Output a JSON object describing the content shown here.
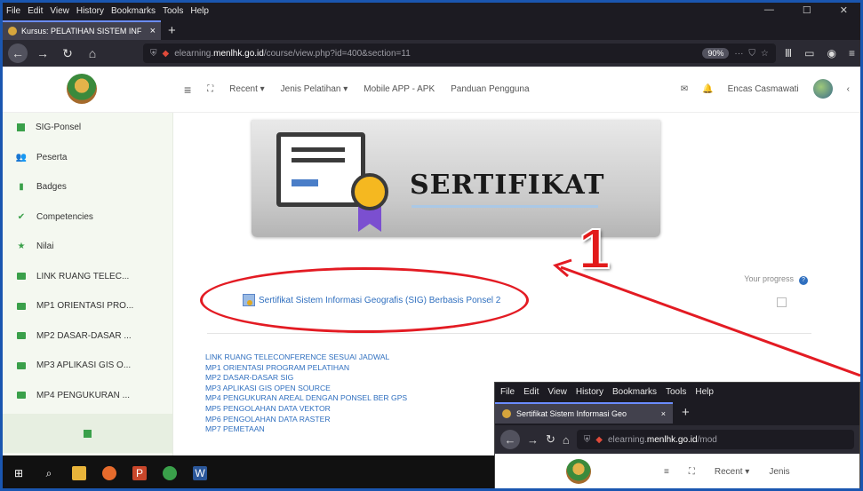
{
  "menubar": {
    "items": [
      "File",
      "Edit",
      "View",
      "History",
      "Bookmarks",
      "Tools",
      "Help"
    ]
  },
  "tab": {
    "title": "Kursus: PELATIHAN SISTEM INF",
    "close": "×",
    "new": "+"
  },
  "url": {
    "prefix": "elearning.",
    "host": "menlhk.go.id",
    "path": "/course/view.php?id=400&section=11",
    "zoom": "90%"
  },
  "topnav": {
    "menu": [
      "Recent ▾",
      "Jenis Pelatihan ▾",
      "Mobile APP - APK",
      "Panduan Pengguna"
    ],
    "user": "Encas Casmawati"
  },
  "sidebar": {
    "items": [
      {
        "label": "SIG-Ponsel",
        "icon": "square"
      },
      {
        "label": "Peserta",
        "icon": "users"
      },
      {
        "label": "Badges",
        "icon": "bookmark"
      },
      {
        "label": "Competencies",
        "icon": "check"
      },
      {
        "label": "Nilai",
        "icon": "star"
      },
      {
        "label": "LINK RUANG TELEC...",
        "icon": "folder"
      },
      {
        "label": "MP1 ORIENTASI PRO...",
        "icon": "folder"
      },
      {
        "label": "MP2 DASAR-DASAR ...",
        "icon": "folder"
      },
      {
        "label": "MP3 APLIKASI GIS O...",
        "icon": "folder"
      },
      {
        "label": "MP4 PENGUKURAN ...",
        "icon": "folder"
      }
    ]
  },
  "banner": {
    "title": "SERTIFIKAT",
    "number": "1"
  },
  "progress": {
    "label": "Your progress",
    "help": "?"
  },
  "activity": {
    "label": "Sertifikat Sistem Informasi Geografis (SIG) Berbasis Ponsel 2"
  },
  "links": [
    "LINK RUANG TELECONFERENCE SESUAI JADWAL",
    "MP1 ORIENTASI PROGRAM PELATIHAN",
    "MP2 DASAR-DASAR SIG",
    "MP3 APLIKASI GIS OPEN SOURCE",
    "MP4 PENGUKURAN AREAL DENGAN PONSEL BER GPS",
    "MP5 PENGOLAHAN DATA VEKTOR",
    "MP6 PENGOLAHAN DATA RASTER",
    "MP7 PEMETAAN"
  ],
  "inset": {
    "menubar": [
      "File",
      "Edit",
      "View",
      "History",
      "Bookmarks",
      "Tools",
      "Help"
    ],
    "tab": "Sertifikat Sistem Informasi Geo",
    "close": "×",
    "new": "+",
    "url_prefix": "elearning.",
    "url_host": "menlhk.go.id",
    "url_path": "/mod",
    "nav": [
      "Recent ▾",
      "Jenis"
    ]
  },
  "colors": {
    "accent": "#2f6fbf",
    "highlight": "#e31b23",
    "sidebar_icon": "#3aa04a"
  }
}
